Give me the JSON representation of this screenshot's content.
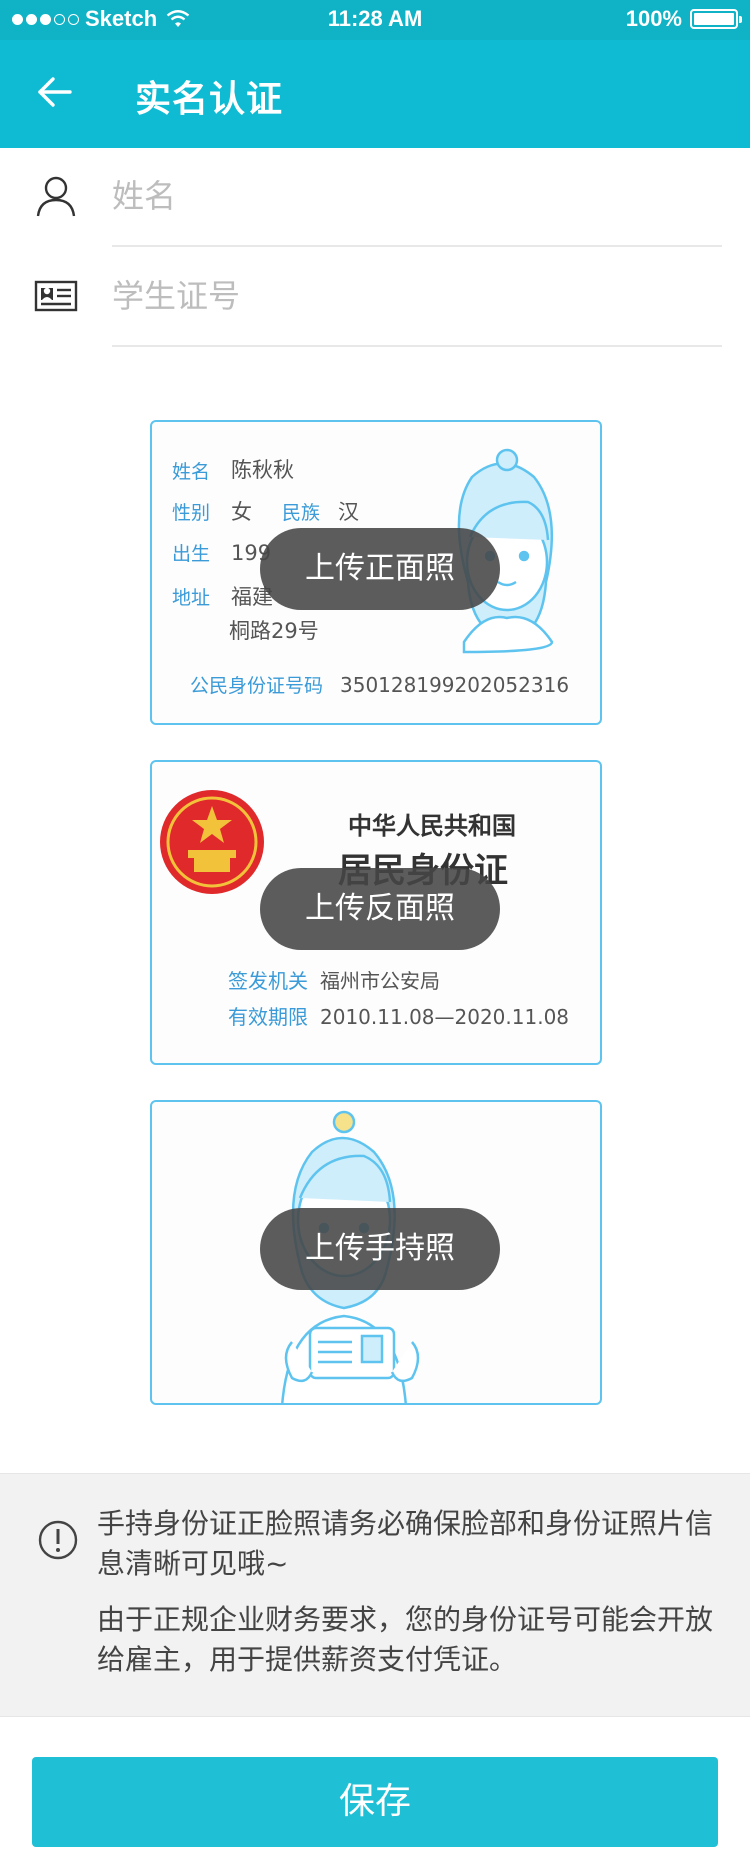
{
  "status_bar": {
    "carrier": "Sketch",
    "time": "11:28 AM",
    "battery": "100%"
  },
  "nav": {
    "title": "实名认证",
    "back_icon": "arrow-left-icon"
  },
  "form": {
    "name_placeholder": "姓名",
    "student_id_placeholder": "学生证号"
  },
  "id_front": {
    "name_label": "姓名",
    "name_value": "陈秋秋",
    "gender_label": "性别",
    "gender_value": "女",
    "ethnicity_label": "民族",
    "ethnicity_value": "汉",
    "birth_label": "出生",
    "birth_value": "199",
    "address_label": "地址",
    "address_line1": "福建",
    "address_line2": "桐路29号",
    "id_label": "公民身份证号码",
    "id_value": "350128199202052316",
    "upload_label": "上传正面照"
  },
  "id_back": {
    "country": "中华人民共和国",
    "card_title": "居民身份证",
    "authority_label": "签发机关",
    "authority_value": "福州市公安局",
    "validity_label": "有效期限",
    "validity_value": "2010.11.08—2020.11.08",
    "upload_label": "上传反面照"
  },
  "handheld": {
    "upload_label": "上传手持照"
  },
  "notice": {
    "line1": "手持身份证正脸照请务必确保脸部和身份证照片信息清晰可见哦~",
    "line2": "由于正规企业财务要求，您的身份证号可能会开放给雇主，用于提供薪资支付凭证。",
    "icon": "exclamation-circle-icon"
  },
  "save_label": "保存",
  "colors": {
    "primary": "#0fbbd3",
    "card_border": "#5ec4ef",
    "label_blue": "#3a9bd8",
    "emblem_red": "#e0292b"
  }
}
